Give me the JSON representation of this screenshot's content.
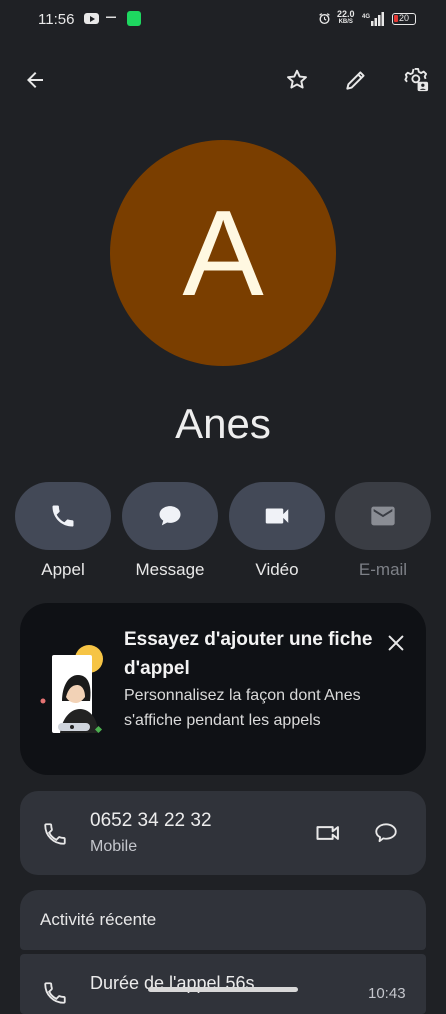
{
  "status_bar": {
    "time": "11:56",
    "net_speed": "22.0",
    "net_unit": "KB/S",
    "network": "4G",
    "battery": "20"
  },
  "top_bar": {
    "icons": [
      "back-arrow-icon",
      "star-icon",
      "edit-pencil-icon",
      "contact-settings-icon"
    ]
  },
  "contact": {
    "initial": "A",
    "name": "Anes",
    "avatar_color": "#7a3e00"
  },
  "actions": [
    {
      "label": "Appel",
      "icon": "phone-icon",
      "enabled": true
    },
    {
      "label": "Message",
      "icon": "message-icon",
      "enabled": true
    },
    {
      "label": "Vidéo",
      "icon": "video-icon",
      "enabled": true
    },
    {
      "label": "E-mail",
      "icon": "email-icon",
      "enabled": false
    }
  ],
  "promo": {
    "title": "Essayez d'ajouter une fiche d'appel",
    "description": "Personnalisez la façon dont Anes s'affiche pendant les appels"
  },
  "phone": {
    "number": "0652 34 22 32",
    "type": "Mobile"
  },
  "recent_activity": {
    "title": "Activité récente",
    "entries": [
      {
        "text": "Durée de l'appel 56s",
        "time": "10:43"
      }
    ]
  },
  "colors": {
    "background": "#1f2125",
    "action_button": "#434957",
    "card": "#30333a",
    "promo_card": "#0f1115"
  }
}
